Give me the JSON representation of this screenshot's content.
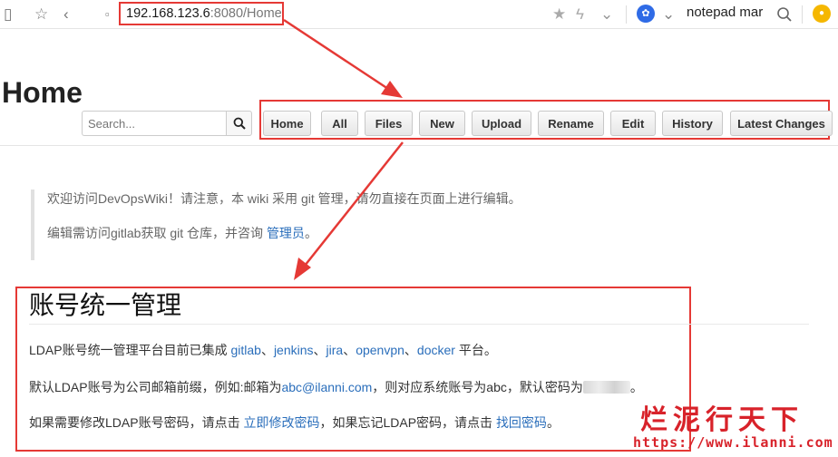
{
  "browser": {
    "url_host": "192.168.123.6",
    "url_path": ":8080/Home",
    "omnibox_search": "notepad mar",
    "toolbar_icons": [
      "star-icon",
      "chevron-left-icon",
      "file-icon",
      "bookmark-star-icon",
      "lightning-icon",
      "paw-icon",
      "chevron-down-icon",
      "search-icon",
      "extension-icon"
    ]
  },
  "page": {
    "title": "Home",
    "search_placeholder": "Search...",
    "nav": [
      "Home",
      "All",
      "Files",
      "New",
      "Upload",
      "Rename",
      "Edit",
      "History",
      "Latest Changes"
    ]
  },
  "notice": {
    "line1": "欢迎访问DevOpsWiki！请注意，本 wiki 采用 git 管理，请勿直接在页面上进行编辑。",
    "line2_prefix": "编辑需访问gitlab获取 git 仓库，并咨询 ",
    "line2_link": "管理员",
    "line2_suffix": "。"
  },
  "section": {
    "title": "账号统一管理",
    "p1_prefix": "LDAP账号统一管理平台目前已集成 ",
    "p1_links": [
      "gitlab",
      "jenkins",
      "jira",
      "openvpn",
      "docker"
    ],
    "p1_sep": "、",
    "p1_suffix": " 平台。",
    "p2_prefix": "默认LDAP账号为公司邮箱前缀，例如:邮箱为",
    "p2_email": "abc@ilanni.com",
    "p2_mid": "，则对应系统账号为abc，默认密码为",
    "p2_suffix": "。",
    "p3_prefix": "如果需要修改LDAP账号密码，请点击 ",
    "p3_link1": "立即修改密码",
    "p3_mid": "，如果忘记LDAP密码，请点击 ",
    "p3_link2": "找回密码",
    "p3_suffix": "。"
  },
  "watermark": {
    "logo": "烂泥行天下",
    "url": "https://www.ilanni.com"
  },
  "colors": {
    "annotation_red": "#e53935",
    "link_blue": "#2a6ebb",
    "watermark_red": "#d8222a"
  }
}
